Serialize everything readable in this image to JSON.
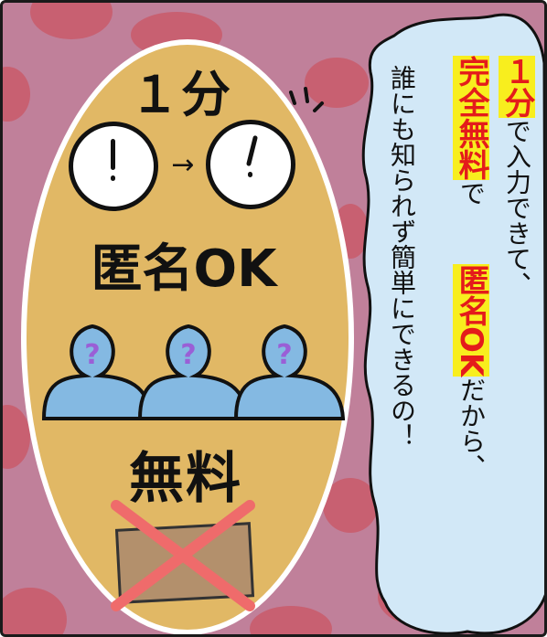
{
  "left_panel": {
    "heading_time": "１分",
    "arrow": "→",
    "heading_anonymous": "匿名OK",
    "person_mark": "?",
    "heading_free": "無料",
    "icons": {
      "clock": "clock-icon",
      "person": "person-silhouette-icon",
      "cross": "cross-mark-icon",
      "envelope": "envelope-icon"
    }
  },
  "speech": {
    "col1": {
      "highlight": "１分",
      "text": "で入力できて、"
    },
    "col2": {
      "highlight": "完全無料",
      "text": "で"
    },
    "col3": {
      "highlight": "匿名OK",
      "text": "だから、"
    },
    "col4": {
      "text": "誰にも知られず簡単にできるの！"
    }
  },
  "colors": {
    "background": "#c0809a",
    "dots": "#c95a6a",
    "oval": "#e1b865",
    "bubble": "#d2e8f7",
    "highlight_bg": "#f8ee1e",
    "highlight_text": "#e41b1b",
    "person": "#84b9e2",
    "question": "#9a5fd6",
    "cross": "#ef6b6b"
  }
}
